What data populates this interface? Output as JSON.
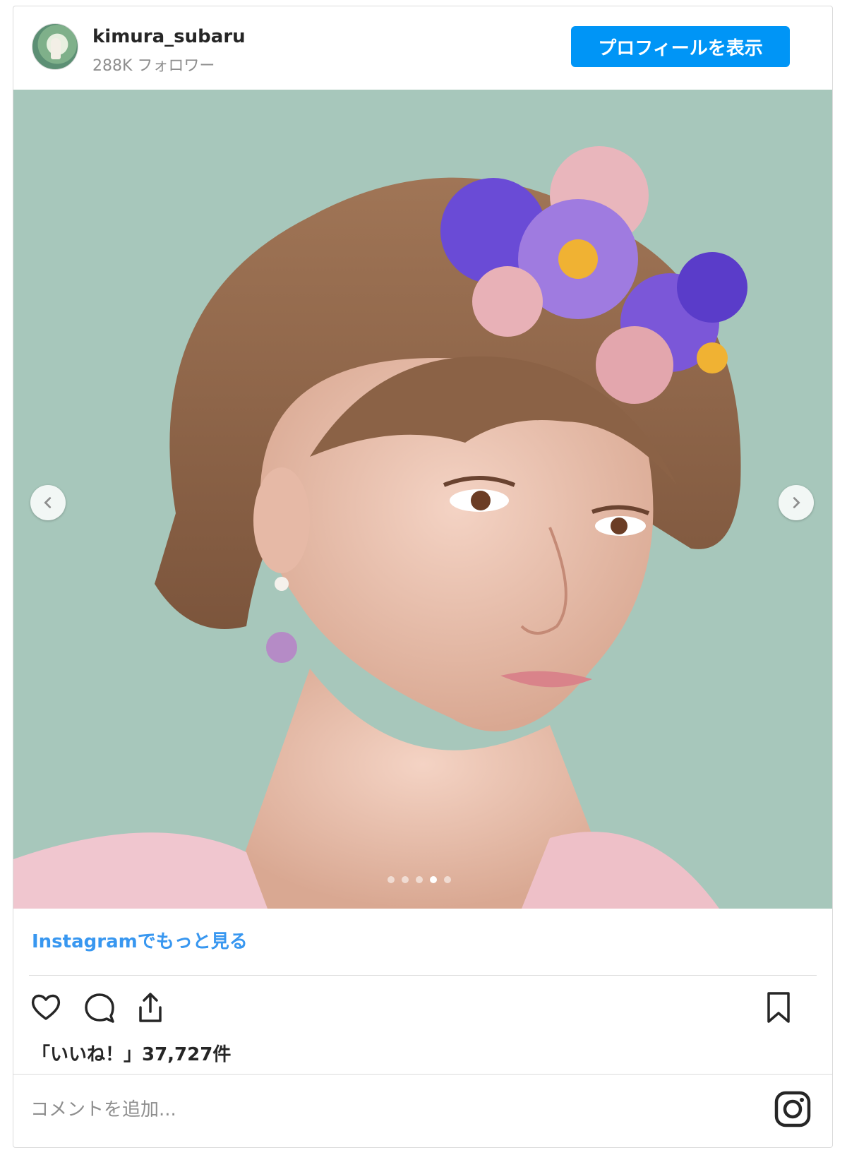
{
  "post": {
    "username": "kimura_subaru",
    "followers": "288K フォロワー",
    "profile_button": "プロフィールを表示",
    "more_link": "Instagramでもっと見る",
    "likes": "「いいね！」37,727件",
    "comment_placeholder": "コメントを追加...",
    "carousel": {
      "total": 5,
      "current": 4
    }
  },
  "icons": [
    "avatar",
    "chevron-left-icon",
    "chevron-right-icon",
    "heart-icon",
    "comment-icon",
    "share-icon",
    "bookmark-icon",
    "instagram-icon"
  ],
  "colors": {
    "accent": "#0095f6",
    "link": "#3897f0",
    "photo_background": "#a7c7bb"
  }
}
